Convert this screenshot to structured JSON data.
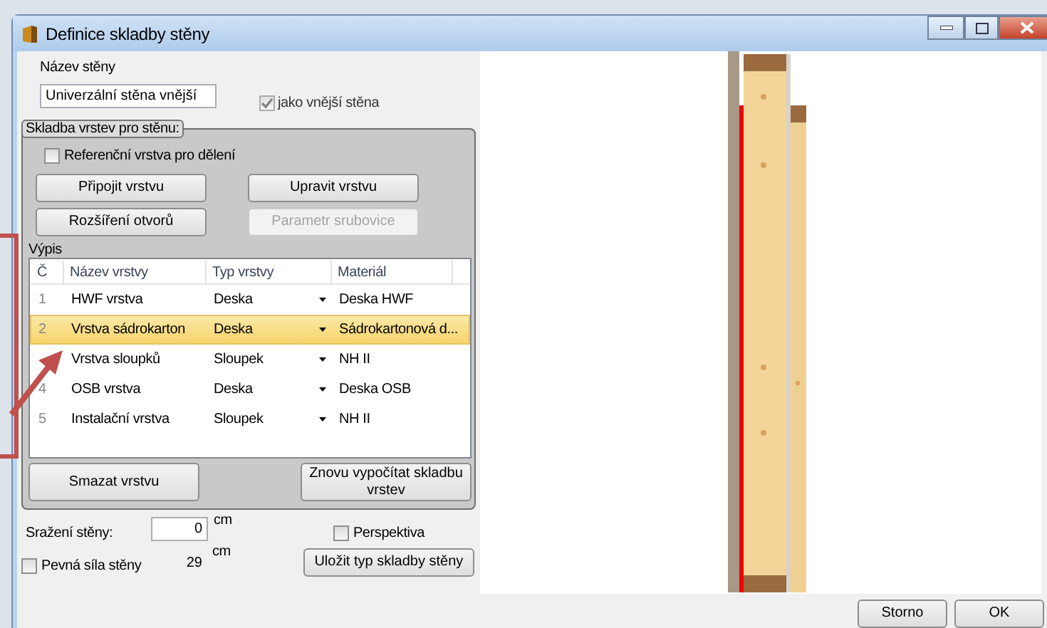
{
  "window": {
    "title": "Definice skladby stěny"
  },
  "wall_name": {
    "label": "Název stěny",
    "value": "Univerzální stěna vnější"
  },
  "outer_wall": {
    "label": "jako vnější stěna",
    "checked": true,
    "disabled": true
  },
  "group": {
    "legend": "Skladba vrstev pro stěnu:",
    "reference": {
      "label": "Referenční vrstva pro dělení",
      "checked": false
    },
    "buttons": [
      {
        "label": "Připojit vrstvu",
        "disabled": false
      },
      {
        "label": "Upravit vrstvu",
        "disabled": false
      },
      {
        "label": "Rozšíření otvorů",
        "disabled": false
      },
      {
        "label": "Parametr srubovice",
        "disabled": true
      }
    ],
    "list_label": "Výpis",
    "table": {
      "columns": [
        "Č",
        "Název vrstvy",
        "Typ vrstvy",
        "Materiál"
      ],
      "rows": [
        {
          "number": "1",
          "name": "HWF vrstva",
          "type": "Deska",
          "material": "Deska HWF",
          "selected": false
        },
        {
          "number": "2",
          "name": "Vrstva sádrokarton",
          "type": "Deska",
          "material": "Sádrokartonová d...",
          "selected": true
        },
        {
          "name": "Vrstva sloupků",
          "type": "Sloupek",
          "material": "NH II",
          "selected": false
        },
        {
          "number": "4",
          "name": "OSB vrstva",
          "type": "Deska",
          "material": "Deska OSB",
          "selected": false
        },
        {
          "number": "5",
          "name": "Instalační vrstva",
          "type": "Sloupek",
          "material": "NH II",
          "selected": false
        }
      ]
    },
    "bottom_buttons": [
      {
        "label": "Smazat vrstvu"
      },
      {
        "label": "Znovu vypočítat skladbu vrstev"
      }
    ]
  },
  "offset": {
    "label": "Sražení stěny:",
    "value": "0",
    "unit": "cm"
  },
  "perspective": {
    "label": "Perspektiva",
    "checked": false
  },
  "fixed": {
    "label": "Pevná síla stěny",
    "checked": false,
    "value": "29",
    "unit": "cm"
  },
  "save_button": "Uložit typ skladby stěny",
  "footer_buttons": [
    "Storno",
    "OK"
  ]
}
